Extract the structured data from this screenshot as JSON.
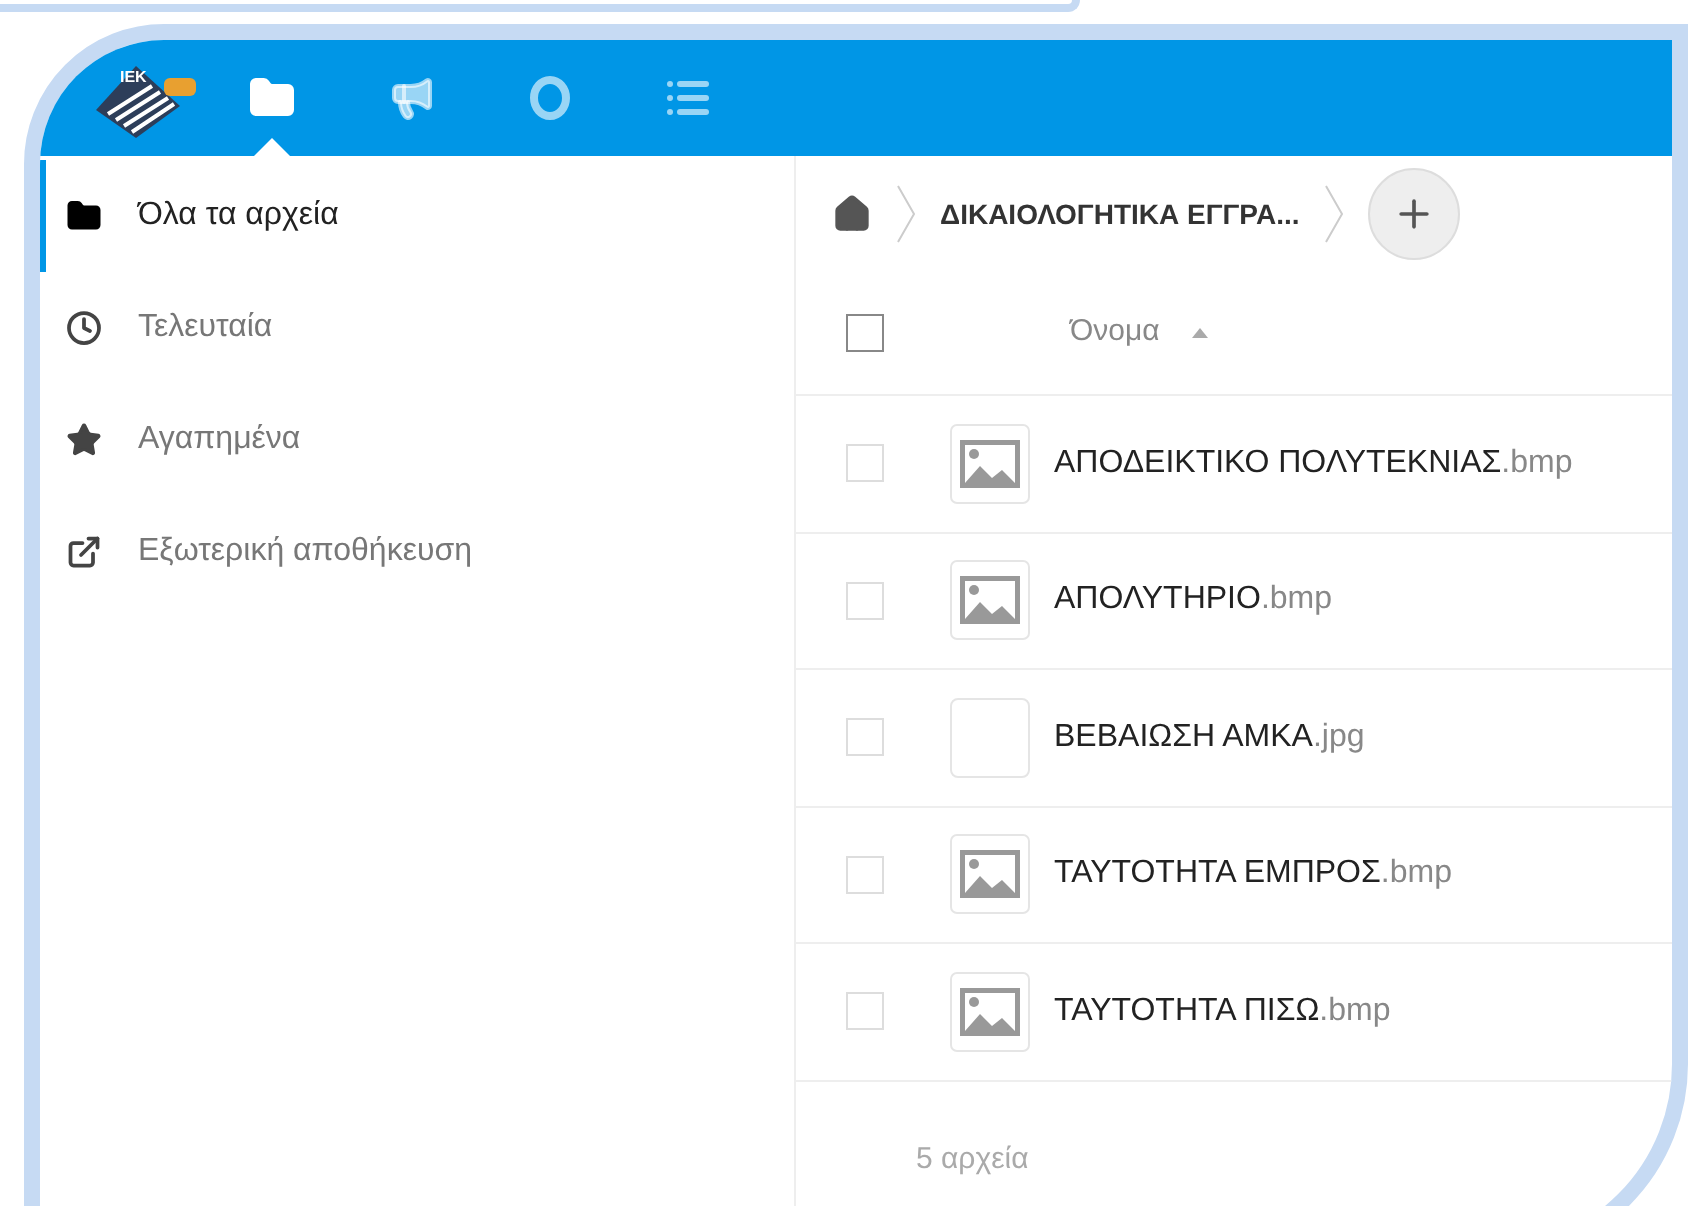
{
  "header": {
    "logo_text": "IEK",
    "apps": [
      {
        "kind": "files",
        "selected": true
      },
      {
        "kind": "activity",
        "selected": false
      },
      {
        "kind": "circle",
        "selected": false
      },
      {
        "kind": "list",
        "selected": false
      }
    ]
  },
  "sidebar": {
    "items": [
      {
        "kind": "folder",
        "label": "Όλα τα αρχεία",
        "selected": true
      },
      {
        "kind": "clock",
        "label": "Τελευταία",
        "selected": false
      },
      {
        "kind": "star",
        "label": "Αγαπημένα",
        "selected": false
      },
      {
        "kind": "external",
        "label": "Εξωτερική αποθήκευση",
        "selected": false
      }
    ]
  },
  "breadcrumb": {
    "folder": "ΔΙΚΑΙΟΛΟΓΗΤΙΚΑ ΕΓΓΡΑ..."
  },
  "table": {
    "select_all": {
      "checked": false
    },
    "column": "Όνομα",
    "rows": [
      {
        "name": "ΑΠΟΔΕΙΚΤΙΚΟ ΠΟΛΥΤΕΚΝΙΑΣ",
        "ext": ".bmp",
        "kind": "image",
        "checked": false
      },
      {
        "name": "ΑΠΟΛΥΤΗΡΙΟ",
        "ext": ".bmp",
        "kind": "image",
        "checked": false
      },
      {
        "name": "ΒΕΒΑΙΩΣΗ ΑΜΚΑ",
        "ext": ".jpg",
        "kind": "blank",
        "checked": false
      },
      {
        "name": "ΤΑΥΤΟΤΗΤΑ ΕΜΠΡΟΣ",
        "ext": ".bmp",
        "kind": "image",
        "checked": false
      },
      {
        "name": "ΤΑΥΤΟΤΗΤΑ ΠΙΣΩ",
        "ext": ".bmp",
        "kind": "image",
        "checked": false
      }
    ],
    "summary": "5 αρχεία"
  }
}
